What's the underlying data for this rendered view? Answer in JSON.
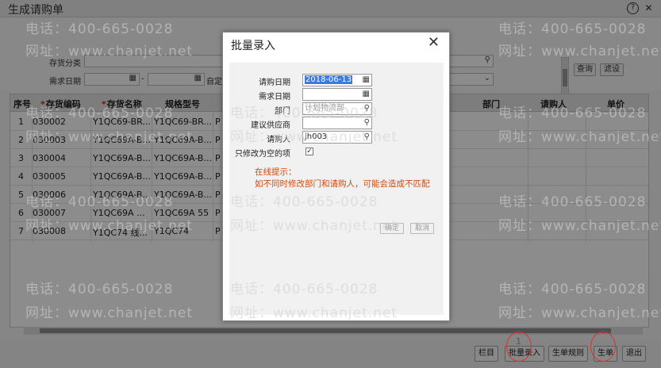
{
  "window": {
    "title": "生成请购单"
  },
  "filter": {
    "category_label": "存货分类",
    "date_label": "需求日期",
    "dash": "-",
    "custom_label": "自定",
    "query_btn": "查询",
    "filter_btn": "滤设"
  },
  "grid": {
    "headers": [
      "序号",
      "存货编码",
      "存货名称",
      "规格型号",
      "部门",
      "请购人",
      "单价"
    ],
    "rows": [
      {
        "no": "1",
        "code": "030002",
        "name": "Y1QC69-BR...",
        "spec": "Y1QC69-BR...",
        "extra": "P"
      },
      {
        "no": "2",
        "code": "030003",
        "name": "Y1QC69A-B...",
        "spec": "Y1QC69A-B...",
        "extra": "P"
      },
      {
        "no": "3",
        "code": "030004",
        "name": "Y1QC69A-B...",
        "spec": "Y1QC69A-B...",
        "extra": "P"
      },
      {
        "no": "4",
        "code": "030005",
        "name": "Y1QC69A-B...",
        "spec": "Y1QC69A-B...",
        "extra": "P"
      },
      {
        "no": "5",
        "code": "030006",
        "name": "Y1QC69A-B...",
        "spec": "Y1QC69A-B...",
        "extra": "P"
      },
      {
        "no": "6",
        "code": "030007",
        "name": "Y1QC69A ...",
        "spec": "Y1QC69A 55",
        "extra": "P"
      },
      {
        "no": "7",
        "code": "030008",
        "name": "Y1QC74 线...",
        "spec": "Y1QC74",
        "extra": "P"
      }
    ]
  },
  "bottom": {
    "buttons": [
      "栏目",
      "批量录入",
      "生单规则",
      "生单",
      "退出"
    ],
    "ring_number": "1"
  },
  "dialog": {
    "title": "批量录入",
    "request_date_label": "请购日期",
    "request_date_value": "2018-06-13",
    "need_date_label": "需求日期",
    "need_date_value": "",
    "dept_label": "部门",
    "dept_placeholder": "计划物流部",
    "supplier_label": "建议供应商",
    "supplier_value": "",
    "requester_label": "请购人",
    "requester_value": "jh003",
    "only_empty_label": "只修改为空的项",
    "only_empty_checked": "✓",
    "hint_title": "在线提示：",
    "hint_text": "如不同时修改部门和请购人，可能会造成不匹配",
    "ok_btn": "确定",
    "cancel_btn": "取消"
  },
  "watermark": {
    "phone": "电话：400-665-0028",
    "site": "网址：www.chanjet.net"
  }
}
